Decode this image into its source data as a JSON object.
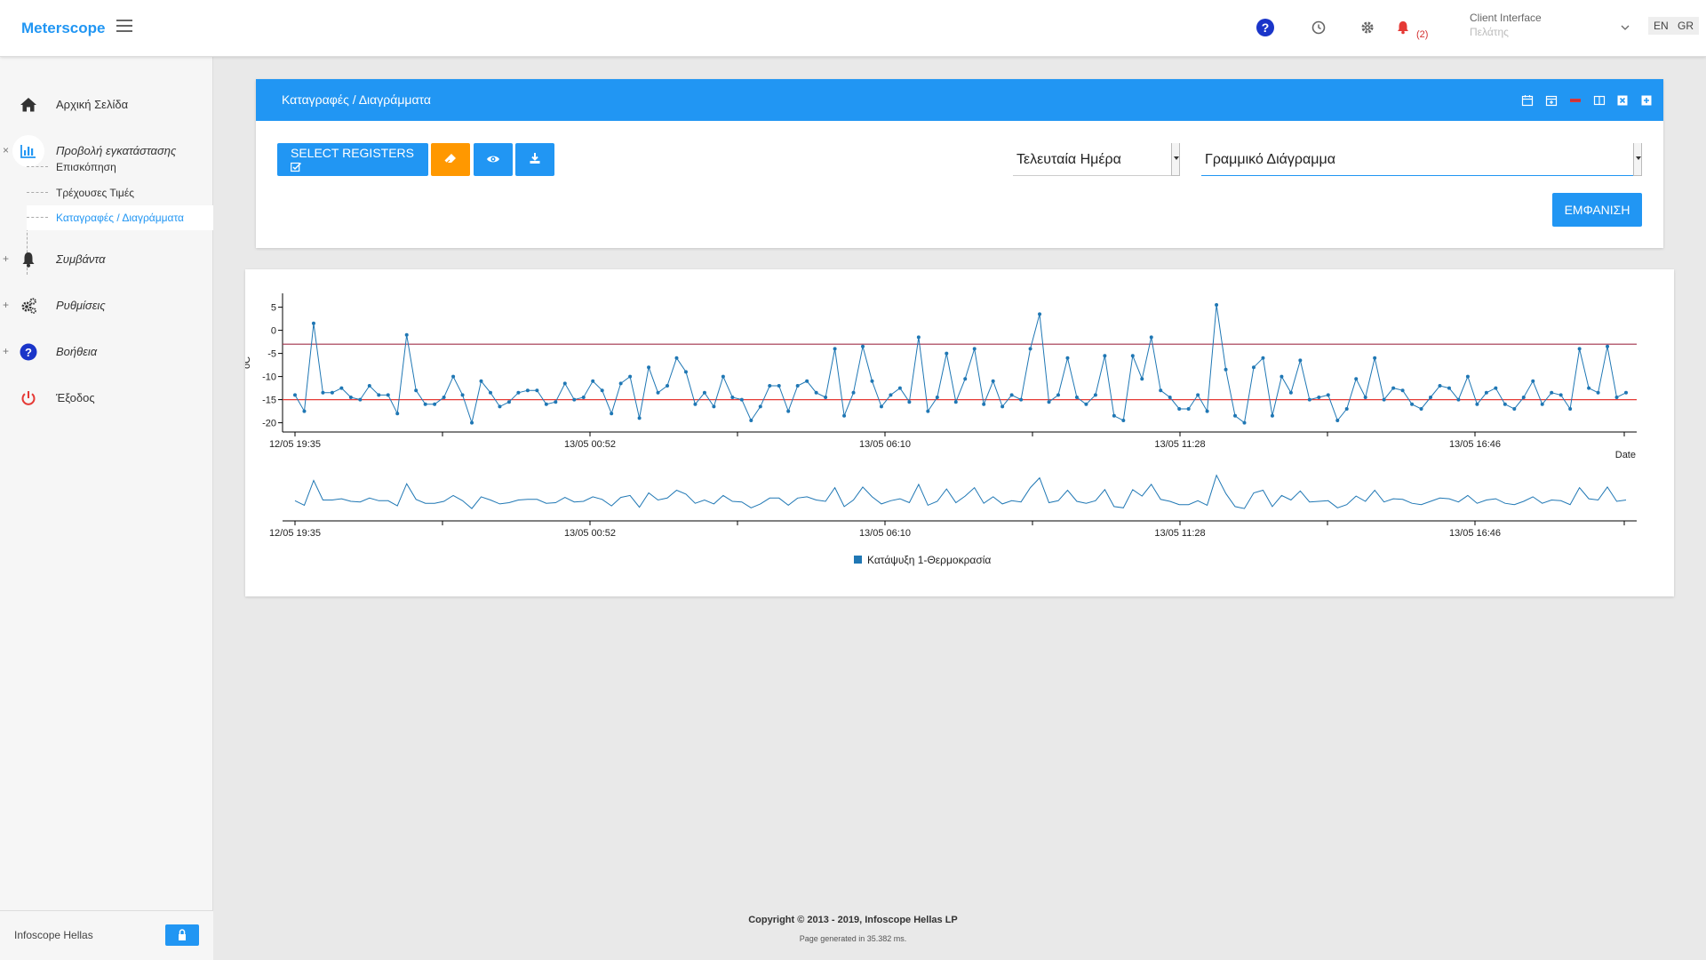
{
  "header": {
    "brand": "Meterscope",
    "notification_count": "(2)",
    "client_label": "Client Interface",
    "client_sub": "Πελάτης",
    "lang_en": "EN",
    "lang_gr": "GR",
    "icons": [
      "menu-icon",
      "help-icon",
      "clock-icon",
      "gear-icon",
      "bell-icon",
      "chevron-down-icon"
    ]
  },
  "sidebar": {
    "items": [
      {
        "label": "Αρχική Σελίδα",
        "icon": "home-icon"
      },
      {
        "label": "Προβολή εγκατάστασης",
        "icon": "bar-chart-icon"
      },
      {
        "label": "Συμβάντα",
        "icon": "bell-icon"
      },
      {
        "label": "Ρυθμίσεις",
        "icon": "gears-icon"
      },
      {
        "label": "Βοήθεια",
        "icon": "help-icon"
      },
      {
        "label": "Έξοδος",
        "icon": "power-icon"
      }
    ],
    "subitems": [
      {
        "label": "Επισκόπηση"
      },
      {
        "label": "Τρέχουσες Τιμές"
      },
      {
        "label": "Καταγραφές / Διαγράμματα"
      }
    ],
    "expand_marks": {
      "open": "×",
      "closed": "+"
    },
    "footer_org": "Infoscope Hellas",
    "lock_icon": "lock-icon"
  },
  "panel": {
    "title": "Καταγραφές / Διαγράμματα",
    "select_registers_label": "SELECT REGISTERS",
    "period_value": "Τελευταία Ημέρα",
    "chart_type_value": "Γραμμικό Διάγραμμα",
    "show_label": "ΕΜΦΑΝΙΣΗ",
    "tool_icons": [
      "calendar-icon",
      "calendar-plus-icon",
      "minus-icon",
      "columns-icon",
      "close-box-icon",
      "plus-box-icon"
    ],
    "colors": {
      "primary": "#2196f3",
      "accent": "#ff9800"
    }
  },
  "chart_data": {
    "type": "line",
    "ylabel": "oC",
    "xlabel": "Date",
    "ylim": [
      -22,
      8
    ],
    "yticks": [
      5,
      0,
      -5,
      -10,
      -15,
      -20
    ],
    "x_tick_labels": [
      "12/05 19:35",
      "13/05 00:52",
      "13/05 06:10",
      "13/05 11:28",
      "13/05 16:46"
    ],
    "thresholds": [
      {
        "value": -3,
        "color": "#a0304a"
      },
      {
        "value": -15,
        "color": "#e53935"
      }
    ],
    "series": [
      {
        "name": "Κατάψυξη 1-Θερμοκρασία",
        "color": "#1f77b4",
        "values": [
          -14,
          -17.5,
          1.5,
          -13.5,
          -13.5,
          -12.5,
          -14.5,
          -15,
          -12,
          -14,
          -14,
          -18,
          -1,
          -13,
          -16,
          -16,
          -14.5,
          -10,
          -14,
          -20,
          -11,
          -13.5,
          -16.5,
          -15.5,
          -13.5,
          -13,
          -13,
          -16,
          -15.5,
          -11.5,
          -15,
          -14.5,
          -11,
          -13,
          -18,
          -11.5,
          -10,
          -19,
          -8,
          -13.5,
          -12,
          -6,
          -9,
          -16,
          -13.5,
          -16.5,
          -10,
          -14.5,
          -15,
          -19.5,
          -16.5,
          -12,
          -12,
          -17.5,
          -12,
          -11,
          -13.5,
          -14.5,
          -4,
          -18.5,
          -13.5,
          -3.5,
          -11,
          -16.5,
          -14,
          -12.5,
          -15.5,
          -1.5,
          -17.5,
          -14.5,
          -5,
          -15.5,
          -10.5,
          -4,
          -16,
          -11,
          -16.5,
          -14,
          -15,
          -4,
          3.5,
          -15.5,
          -14,
          -6,
          -14.5,
          -16,
          -14,
          -5.5,
          -18.5,
          -19.5,
          -5.5,
          -10.5,
          -1.5,
          -13,
          -14.5,
          -17,
          -17,
          -14,
          -17.5,
          5.5,
          -8.5,
          -18.5,
          -20,
          -8,
          -6,
          -18.5,
          -10,
          -13.5,
          -6.5,
          -15,
          -14.5,
          -14,
          -19.5,
          -17,
          -10.5,
          -14.5,
          -6,
          -15,
          -12.5,
          -13,
          -16,
          -17,
          -14.5,
          -12,
          -12.5,
          -15,
          -10,
          -16,
          -13.5,
          -12.5,
          -16,
          -17,
          -14.5,
          -11,
          -16,
          -13.5,
          -14,
          -17,
          -4,
          -12.5,
          -13.5,
          -3.5,
          -14.5,
          -13.5
        ]
      }
    ],
    "legend_placement": "bottom-center",
    "navigator": true
  },
  "footer": {
    "copyright": "Copyright © 2013 - 2019, Infoscope Hellas LP",
    "page_generated": "Page generated in 35.382 ms."
  }
}
